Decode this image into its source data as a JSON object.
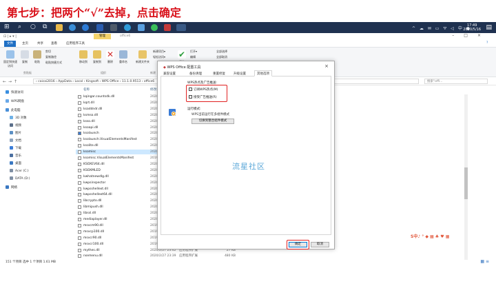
{
  "caption": "第七步：把两个“√”去掉，点击确定",
  "taskbar": {
    "time": "17:49",
    "date": "2020/5/16",
    "tray_text": "中"
  },
  "explorer": {
    "quick_access": "⊡ | ▸ ▾ |",
    "manage_tab": "管理",
    "app_name": "office6",
    "ribbon_tabs": [
      "文件",
      "主页",
      "共享",
      "查看",
      "应用程序工具"
    ],
    "ribbon": {
      "pin": "固定到快速访问",
      "copy": "复制",
      "paste": "粘贴",
      "cut": "剪切",
      "copy_path": "复制路径",
      "paste_shortcut": "粘贴快捷方式",
      "move_to": "移动到",
      "copy_to": "复制到",
      "delete": "删除",
      "rename": "重命名",
      "new_folder": "新建文件夹",
      "new_item": "新建项目▾",
      "easy_access": "轻松访问▾",
      "properties": "属性",
      "open": "打开▾",
      "edit": "编辑",
      "history": "历史记录",
      "select_all": "全部选择",
      "select_none": "全部取消",
      "invert": "反向选择",
      "group_clipboard": "剪贴板",
      "group_organize": "组织",
      "group_new": "新建",
      "group_open": "打开",
      "group_select": "选择"
    },
    "address": "› caicai2016 › AppData › Local › Kingsoft › WPS Office › 11.1.0.9513 › office6",
    "search_placeholder": "搜索\"offi...",
    "columns": {
      "name": "名称",
      "date": "修改日期"
    },
    "sidebar": [
      {
        "label": "快速访问",
        "color": "#3a8fe0"
      },
      {
        "label": "WPS网盘",
        "color": "#6aa8e8"
      },
      {
        "label": "此电脑",
        "color": "#4a90d9"
      },
      {
        "label": "3D 对象",
        "color": "#6fb1e6"
      },
      {
        "label": "视频",
        "color": "#5b6f8a"
      },
      {
        "label": "图片",
        "color": "#5b8fc4"
      },
      {
        "label": "文档",
        "color": "#8da3bd"
      },
      {
        "label": "下载",
        "color": "#3b7dd8"
      },
      {
        "label": "音乐",
        "color": "#4a6fa0"
      },
      {
        "label": "桌面",
        "color": "#3a78c2"
      },
      {
        "label": "Acer (C:)",
        "color": "#7f8fa3"
      },
      {
        "label": "DATA (D:)",
        "color": "#7f8fa3"
      },
      {
        "label": "网络",
        "color": "#3a78c2"
      }
    ],
    "files": [
      {
        "name": "kqingar.countsdk.dll",
        "date": "2020/",
        "type": "",
        "size": ""
      },
      {
        "name": "kqrt.dll",
        "date": "2020/",
        "type": "",
        "size": ""
      },
      {
        "name": "ksaddndr.dll",
        "date": "2020/",
        "type": "",
        "size": ""
      },
      {
        "name": "ksmso.dll",
        "date": "2020/",
        "type": "",
        "size": ""
      },
      {
        "name": "ksso.dll",
        "date": "2020/",
        "type": "",
        "size": ""
      },
      {
        "name": "ksoapi.dll",
        "date": "2020/",
        "type": "",
        "size": ""
      },
      {
        "name": "ksolaunch",
        "date": "2020/",
        "type": "",
        "size": ""
      },
      {
        "name": "ksolaunch.VisualElementsManifest",
        "date": "2020/",
        "type": "",
        "size": ""
      },
      {
        "name": "ksolite.dll",
        "date": "2020/",
        "type": "",
        "size": ""
      },
      {
        "name": "ksomisc",
        "date": "2020/",
        "type": "",
        "size": "",
        "selected": true
      },
      {
        "name": "ksomisc.VisualElementsManifest",
        "date": "2019/",
        "type": "",
        "size": ""
      },
      {
        "name": "KSOXEV64.dll",
        "date": "2020/",
        "type": "",
        "size": ""
      },
      {
        "name": "KSOXMLED",
        "date": "2020/",
        "type": "",
        "size": ""
      },
      {
        "name": "kwhatnewdlg.dll",
        "date": "2020/",
        "type": "",
        "size": ""
      },
      {
        "name": "kwpsinspector",
        "date": "2020/",
        "type": "",
        "size": ""
      },
      {
        "name": "kwpsshellext.dll",
        "date": "2020/",
        "type": "",
        "size": ""
      },
      {
        "name": "kwpsshellext64.dll",
        "date": "2020/",
        "type": "",
        "size": ""
      },
      {
        "name": "libcrypto.dll",
        "date": "2020/",
        "type": "",
        "size": ""
      },
      {
        "name": "libmipush.dll",
        "date": "2020/",
        "type": "",
        "size": ""
      },
      {
        "name": "libssl.dll",
        "date": "2020/",
        "type": "",
        "size": ""
      },
      {
        "name": "mediaplayer.dll",
        "date": "2020/",
        "type": "",
        "size": ""
      },
      {
        "name": "msvcm90.dll",
        "date": "2019/",
        "type": "",
        "size": ""
      },
      {
        "name": "msvcp100.dll",
        "date": "2019/",
        "type": "",
        "size": ""
      },
      {
        "name": "msvcr90.dll",
        "date": "2019/10/1 12:47",
        "type": "应用程序扩展",
        "size": "638 KB"
      },
      {
        "name": "msvcr100.dll",
        "date": "2019/10/1 12:47",
        "type": "应用程序扩展",
        "size": "756 KB"
      },
      {
        "name": "mythes.dll",
        "date": "2020/2/27 23:42",
        "type": "应用程序扩展",
        "size": "27 KB"
      },
      {
        "name": "nsemenu.dll",
        "date": "2020/2/27 23:39",
        "type": "应用程序扩展",
        "size": "480 KB"
      }
    ],
    "status": "151 个项目   选中 1 个项目  1.61 MB"
  },
  "dialog": {
    "title": "WPS Office 配置工具",
    "close": "×",
    "tabs": [
      "兼容设置",
      "备份清理",
      "重置修复",
      "升级设置",
      "其他选项"
    ],
    "active_tab": 4,
    "group1_label": "WPS热点及广告推送:",
    "opt1_label": "订阅WPS热点(M)",
    "opt2_label": "接受广告推送(R)",
    "group2_label": "运行模式:",
    "hint": "WPS当前运行在多组件模式",
    "switch_button": "切换到整合组件模式",
    "ok": "确定",
    "cancel": "取消"
  },
  "watermark": "流星社区",
  "ime_bar": "S中♪ ° ◆ ▦ ♣ ♥ ▦"
}
